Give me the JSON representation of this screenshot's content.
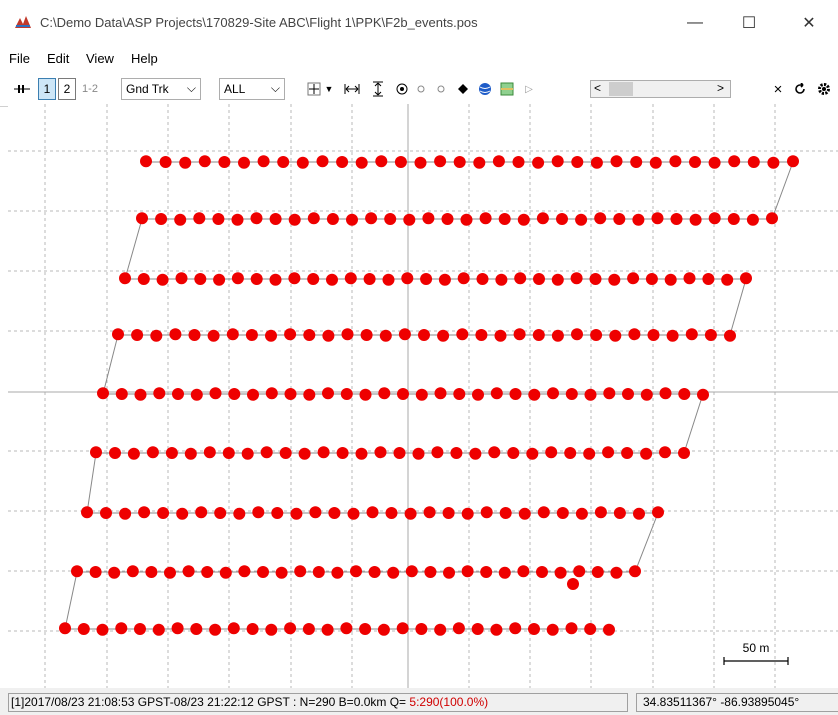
{
  "window": {
    "title": "C:\\Demo Data\\ASP Projects\\170829-Site ABC\\Flight 1\\PPK\\F2b_events.pos",
    "minimize_glyph": "—",
    "maximize_glyph": "☐",
    "close_glyph": "✕"
  },
  "menu": {
    "items": [
      "File",
      "Edit",
      "View",
      "Help"
    ]
  },
  "toolbar": {
    "btn1": "1",
    "btn2": "2",
    "btn12": "1-2",
    "plot_type": "Gnd Trk",
    "quality": "ALL",
    "icons": [
      "center-icon",
      "dropdown-icon",
      "fit-horizontal-icon",
      "fit-vertical-icon",
      "show-point-icon",
      "small-circle-icon",
      "small-circle2-icon",
      "diamond-icon",
      "globe-icon",
      "map-icon",
      "play-icon",
      "scroll-left-icon",
      "scroll-right-icon",
      "close-icon",
      "reload-icon",
      "settings-icon"
    ]
  },
  "plot": {
    "scale_label": "50 m",
    "point_color": "#ee0000",
    "line_color": "#888888",
    "grid_color": "#b8b8b8",
    "axis_color": "#a8a8a8"
  },
  "status": {
    "left_prefix": "[1]2017/08/23 21:08:53 GPST-08/23 21:22:12 GPST : N=290 B=0.0km Q= ",
    "left_quality": "5:290(100.0%)",
    "right": "34.83511367°  -86.93895045°"
  }
}
